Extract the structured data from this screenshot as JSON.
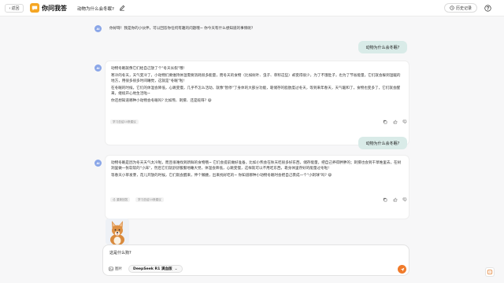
{
  "header": {
    "back_label": "返回",
    "app_title": "你问我答",
    "conversation_title": "动物为什么会冬眠?",
    "history_label": "历史记录"
  },
  "chat": {
    "greeting": "你好呀！我是你的小伙伴，可以回答你任何有趣的问题哦~ 你今天有什么想知道的事情呢?",
    "q1": "动物为什么会冬眠?",
    "a1": {
      "p1": "动物冬眠就像它们给自己放了个\"冬天长假\"哦!",
      "p2": "寒冷的冬天，天气变冷了，小动物们要维持体温需要消耗很多能量，而冬天的食物（比如树叶、虫子、草籽这些）却变得很少，为了不饿肚子，也为了节省能量，它们就会躲到温暖的地方，用很多很多时间睡觉，这就是\"冬眠\"啦!",
      "p3": "在冬眠的时候，它们的体温会降低，心跳变慢，几乎不怎么活动，就像\"暂停\"了身体的大部分功能，靠储存的脂肪度过冬天，等到来年春天，天气暖和了，食物也变多了，它们就会醒来，继续开心地生活啦~",
      "p4": "你还想知道哪种小动物会冬眠吗? 比如熊、刺猬、还是蛇呀? 😄",
      "tag": "学习总结14条建议"
    },
    "q2": "动物为什么会冬眠?",
    "a2": {
      "p1": "动物冬眠是因为冬天天气太冷啦，而且很难找到新鲜的食物哦~ 它们会提前做好准备，比如小熊会在秋天吃很多好东西，储存能量，把自己养得胖胖的；刺猬也会到干草堆里去，在树洞里做一张软软的\"小床\"，然后它们就舒舒服服地睡大觉，体温会降低，心跳变慢，这样就可以不用吃东西，靠身体里存好的能量过冬啦!",
      "p2": "等春天小草发芽，花儿开放的时候，它们就会醒来，伸个懒腰，出来找好吃的~ 你知道哪种小动物冬眠时会把自己裹成一个\"小刺球\"吗? 😄",
      "tag_left": "重新回答",
      "tag": "学习总结14条建议"
    }
  },
  "input": {
    "attachment_alt": "corgi dog photo",
    "text": "这是什么狗?",
    "image_label": "图片",
    "model_label": "DeepSeek R1 满血版"
  },
  "colors": {
    "accent": "#f07a2a",
    "user_bubble": "#d9ebe8",
    "logo": "#f5a623"
  }
}
